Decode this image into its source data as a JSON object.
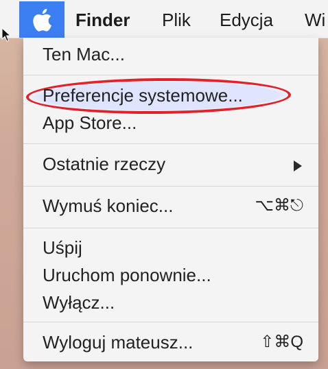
{
  "menubar": {
    "apple_icon": "apple-logo-icon",
    "items": [
      {
        "label": "Finder"
      },
      {
        "label": "Plik"
      },
      {
        "label": "Edycja"
      },
      {
        "label": "Wi"
      }
    ]
  },
  "apple_menu": {
    "items": [
      {
        "label": "Ten Mac..."
      },
      {
        "label": "Preferencje systemowe..."
      },
      {
        "label": "App Store..."
      },
      {
        "label": "Ostatnie rzeczy",
        "icon": "submenu-arrow-icon"
      },
      {
        "label": "Wymuś koniec...",
        "shortcut": "⌥⌘⎋"
      },
      {
        "label": "Uśpij"
      },
      {
        "label": "Uruchom ponownie..."
      },
      {
        "label": "Wyłącz..."
      },
      {
        "label": "Wyloguj mateusz...",
        "shortcut": "⇧⌘Q"
      }
    ],
    "highlight_color": "#e0232b",
    "highlight_fill": "#dfe5ff"
  }
}
